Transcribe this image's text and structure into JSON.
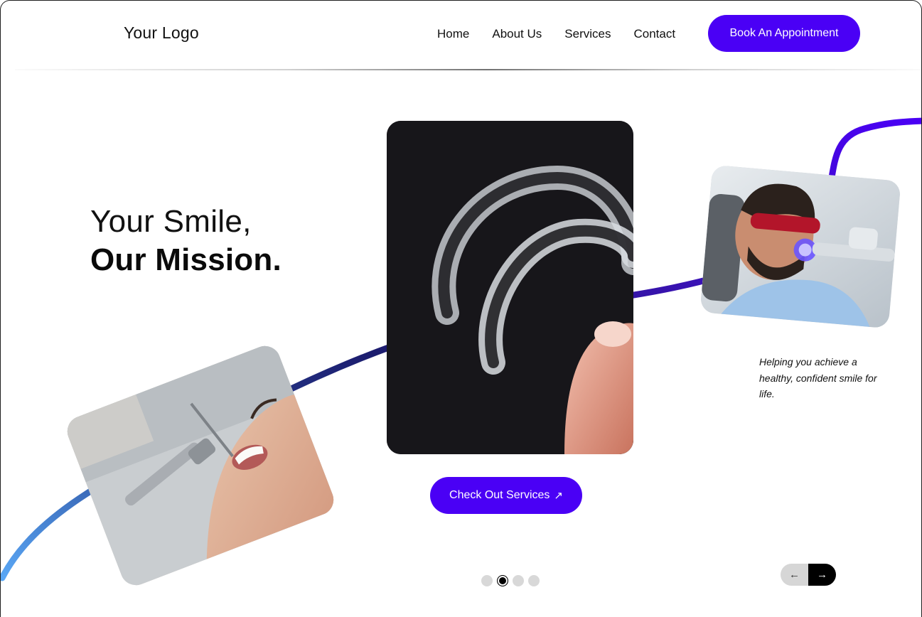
{
  "header": {
    "logo": "Your Logo",
    "nav": [
      "Home",
      "About Us",
      "Services",
      "Contact"
    ],
    "cta": "Book An Appointment"
  },
  "hero": {
    "line1": "Your Smile,",
    "line2": "Our Mission."
  },
  "tagline": "Helping you achieve a healthy, confident smile for life.",
  "services_button": {
    "label": "Check Out Services",
    "icon": "arrow-up-right-icon"
  },
  "carousel": {
    "slide_count": 4,
    "active_index": 1
  },
  "pager": {
    "prev_icon": "arrow-left-icon",
    "next_icon": "arrow-right-icon"
  },
  "colors": {
    "accent": "#4a00f5",
    "curve_start": "#5aa7f5",
    "curve_mid": "#1c1c6e",
    "curve_end": "#4a00f5"
  },
  "images": {
    "center": "clear-aligner-trays-photo",
    "right": "teeth-whitening-patient-photo",
    "left": "dental-checkup-patient-photo"
  }
}
